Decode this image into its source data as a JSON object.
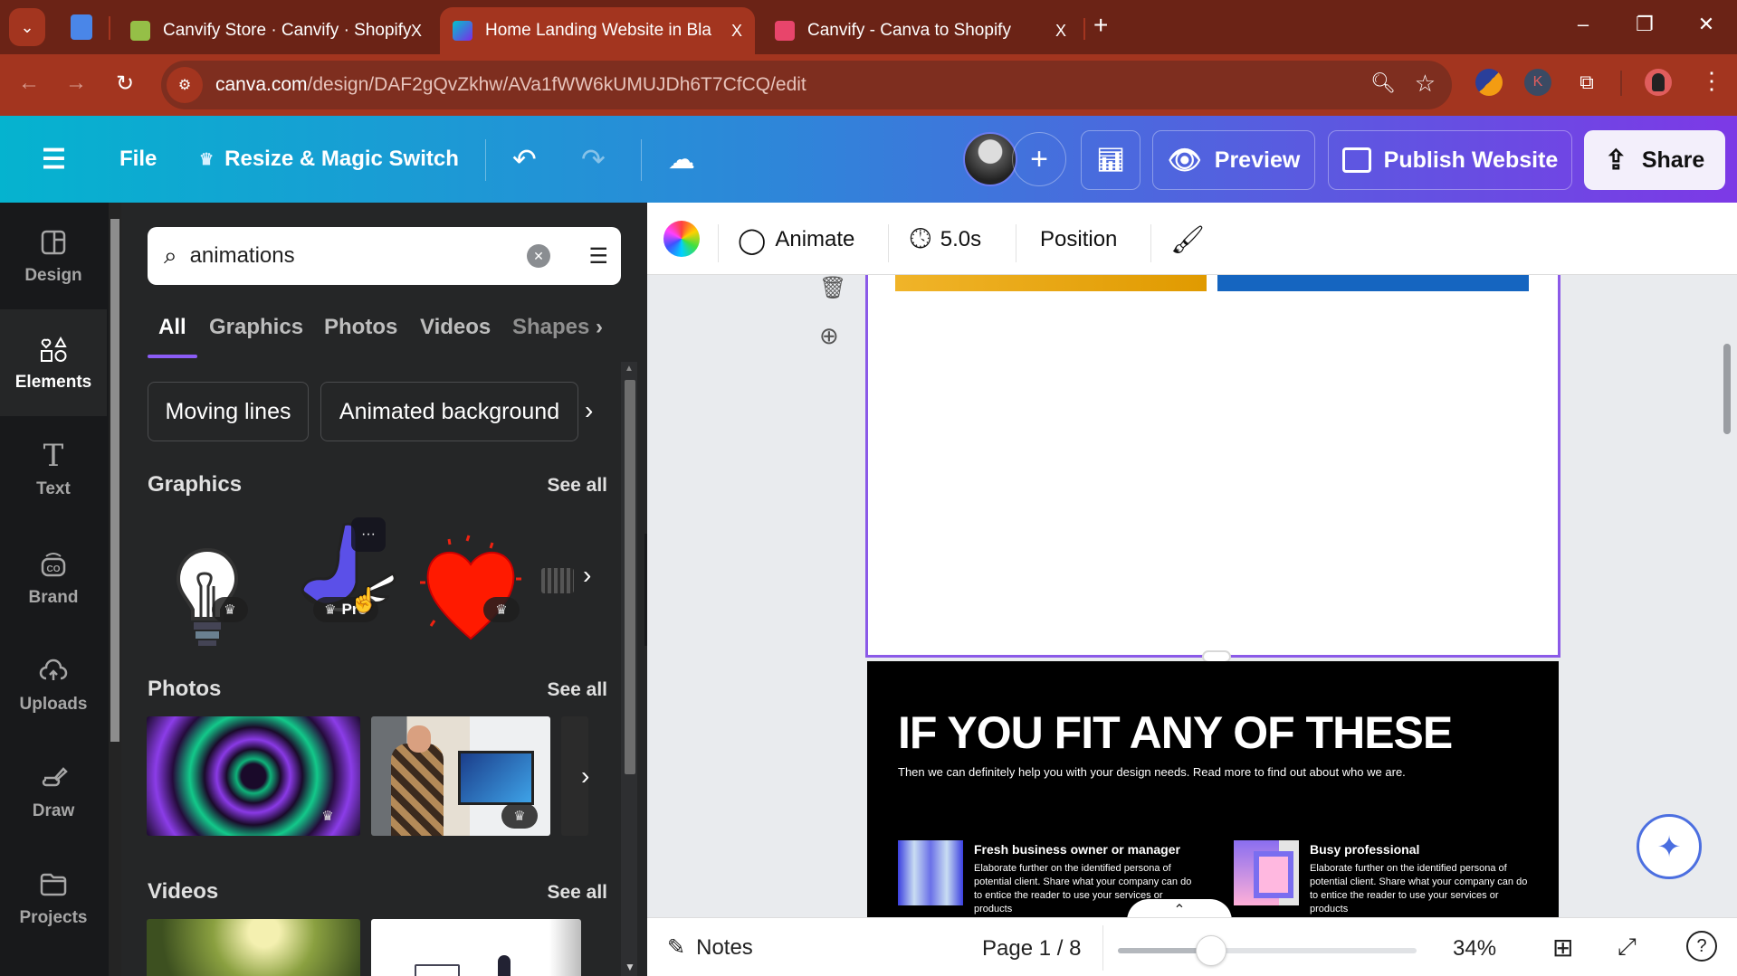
{
  "browser": {
    "tabs": [
      {
        "title": "Canvify Store · Canvify · Shopify",
        "favicon": "shopify-icon",
        "active": false
      },
      {
        "title": "Home Landing Website in Black",
        "favicon": "canva-icon",
        "active": true
      },
      {
        "title": "Canvify - Canva to Shopify",
        "favicon": "canvify-icon",
        "active": false
      }
    ],
    "url_host": "canva.com",
    "url_path": "/design/DAF2gQvZkhw/AVa1fWW6kUMUJDh6T7CfCQ/edit",
    "extension_k_label": "K",
    "new_tab_label": "+",
    "close_label": "X"
  },
  "header": {
    "file_label": "File",
    "resize_label": "Resize & Magic Switch",
    "preview_label": "Preview",
    "publish_label": "Publish Website",
    "share_label": "Share",
    "add_label": "+"
  },
  "rail": {
    "items": [
      {
        "label": "Design",
        "icon": "design-icon"
      },
      {
        "label": "Elements",
        "icon": "elements-icon",
        "active": true
      },
      {
        "label": "Text",
        "icon": "text-icon"
      },
      {
        "label": "Brand",
        "icon": "brand-icon"
      },
      {
        "label": "Uploads",
        "icon": "uploads-icon"
      },
      {
        "label": "Draw",
        "icon": "draw-icon"
      },
      {
        "label": "Projects",
        "icon": "projects-icon"
      }
    ]
  },
  "panel": {
    "search_value": "animations",
    "tabs": [
      "All",
      "Graphics",
      "Photos",
      "Videos",
      "Shapes"
    ],
    "active_tab": "All",
    "chips": [
      "Moving lines",
      "Animated background"
    ],
    "sections": {
      "graphics": {
        "title": "Graphics",
        "see_all": "See all",
        "pro_label": "Pro",
        "more_label": "···"
      },
      "photos": {
        "title": "Photos",
        "see_all": "See all"
      },
      "videos": {
        "title": "Videos",
        "see_all": "See all"
      }
    }
  },
  "context_toolbar": {
    "animate_label": "Animate",
    "duration_label": "5.0s",
    "position_label": "Position"
  },
  "canvas": {
    "headline": "IF YOU FIT ANY OF THESE",
    "subline": "Then we can definitely help you with your design needs. Read more to find out about who we are.",
    "personas": [
      {
        "title": "Fresh business owner or manager",
        "body": "Elaborate further on the identified persona of potential client. Share what your company can do to entice the reader to use your services or products"
      },
      {
        "title": "Busy professional",
        "body": "Elaborate further on the identified persona of potential client. Share what your company can do to entice the reader to use your services or products"
      }
    ]
  },
  "footer": {
    "notes_label": "Notes",
    "page_label": "Page 1 / 8",
    "zoom_label": "34%",
    "zoom_percent": 34
  },
  "colors": {
    "accent": "#8b5ae8",
    "browser_frame": "#a3351f"
  }
}
